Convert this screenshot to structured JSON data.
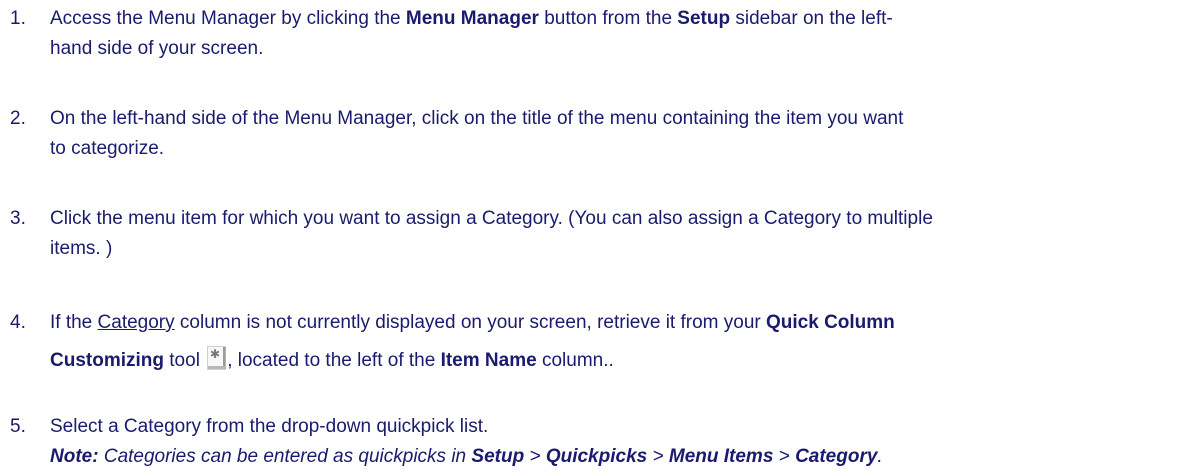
{
  "steps": [
    {
      "num": "1.",
      "t1": "Access the Menu Manager by clicking the ",
      "b1": "Menu Manager",
      "t2": " button from the ",
      "b2": "Setup",
      "t3": " sidebar on the left-",
      "t4": "hand side of your screen."
    },
    {
      "num": "2.",
      "line1": "On the left-hand side of the Menu Manager, click on the title of the menu containing the item you want",
      "line2": "to categorize."
    },
    {
      "num": "3.",
      "line1": "Click the menu item for which you want to assign a Category. (You can also assign a Category to multiple",
      "line2": "items. )"
    },
    {
      "num": "4.",
      "t1": "If the ",
      "u1": "Category",
      "t2": " column is not currently displayed on your screen, retrieve it from your ",
      "b1": "Quick Column",
      "b2": "Customizing",
      "t3": " tool ",
      "icon": "column-customizing-tool-icon",
      "t4": ", located to the left of the ",
      "b3": "Item Name",
      "t5": " column.."
    },
    {
      "num": "5.",
      "line1": "Select a Category from the drop-down quickpick list.",
      "note_label": "Note:",
      "note_t1": " Categories can be entered as quickpicks in ",
      "note_b1": "Setup",
      "note_sep1": " > ",
      "note_b2": "Quickpicks",
      "note_sep2": " > ",
      "note_b3": "Menu Items",
      "note_sep3": " > ",
      "note_b4": "Category",
      "note_end": "."
    }
  ]
}
